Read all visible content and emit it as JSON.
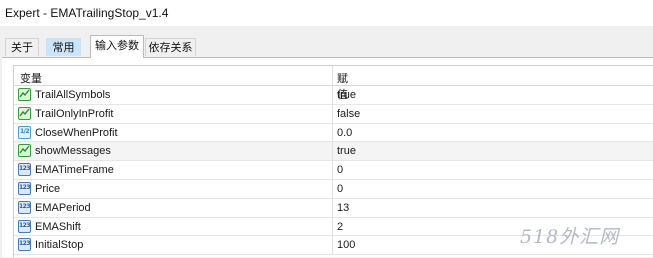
{
  "window": {
    "title": "Expert - EMATrailingStop_v1.4"
  },
  "tabs": [
    {
      "label": "关于"
    },
    {
      "label": "常用"
    },
    {
      "label": "输入参数"
    },
    {
      "label": "依存关系"
    }
  ],
  "grid": {
    "columns": {
      "name": "变量",
      "value": "赋值"
    },
    "rows": [
      {
        "icon": "boolean-param-icon",
        "name": "TrailAllSymbols",
        "value": "true"
      },
      {
        "icon": "boolean-param-icon",
        "name": "TrailOnlyInProfit",
        "value": "false"
      },
      {
        "icon": "double-param-icon",
        "name": "CloseWhenProfit",
        "value": "0.0"
      },
      {
        "icon": "boolean-param-icon",
        "name": "showMessages",
        "value": "true"
      },
      {
        "icon": "integer-param-icon",
        "name": "EMATimeFrame",
        "value": "0"
      },
      {
        "icon": "integer-param-icon",
        "name": "Price",
        "value": "0"
      },
      {
        "icon": "integer-param-icon",
        "name": "EMAPeriod",
        "value": "13"
      },
      {
        "icon": "integer-param-icon",
        "name": "EMAShift",
        "value": "2"
      },
      {
        "icon": "integer-param-icon",
        "name": "InitialStop",
        "value": "100"
      }
    ]
  },
  "icon_glyphs": {
    "integer": "123",
    "double": "1/2"
  },
  "watermark": "518外汇网",
  "colors": {
    "selected_tab_bg": "#ffffff",
    "hover_tab_bg": "#cce4f7",
    "alt_row": "#f4f4f4"
  }
}
